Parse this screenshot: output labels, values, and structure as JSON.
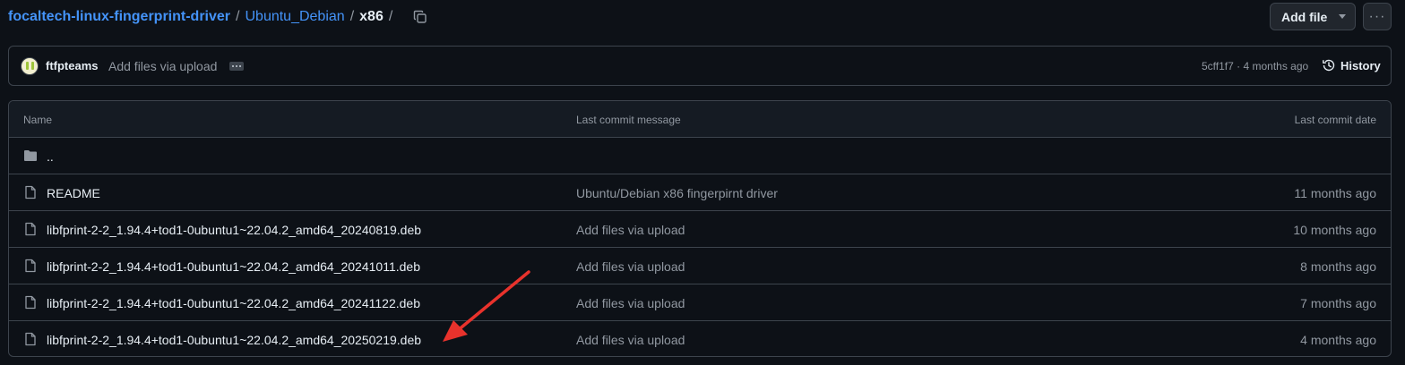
{
  "breadcrumb": {
    "repo": "focaltech-linux-fingerprint-driver",
    "sep1": "/",
    "folder": "Ubuntu_Debian",
    "sep2": "/",
    "current": "x86",
    "sep3": "/"
  },
  "toolbar": {
    "add_file_label": "Add file",
    "more_label": "···"
  },
  "commit": {
    "author": "ftfpteams",
    "message": "Add files via upload",
    "meta": "5cff1f7 · 4 months ago",
    "history_label": "History"
  },
  "table": {
    "headers": {
      "name": "Name",
      "message": "Last commit message",
      "date": "Last commit date"
    },
    "parent_label": "..",
    "rows": [
      {
        "name": "README",
        "message": "Ubuntu/Debian x86 fingerpirnt driver",
        "date": "11 months ago"
      },
      {
        "name": "libfprint-2-2_1.94.4+tod1-0ubuntu1~22.04.2_amd64_20240819.deb",
        "message": "Add files via upload",
        "date": "10 months ago"
      },
      {
        "name": "libfprint-2-2_1.94.4+tod1-0ubuntu1~22.04.2_amd64_20241011.deb",
        "message": "Add files via upload",
        "date": "8 months ago"
      },
      {
        "name": "libfprint-2-2_1.94.4+tod1-0ubuntu1~22.04.2_amd64_20241122.deb",
        "message": "Add files via upload",
        "date": "7 months ago"
      },
      {
        "name": "libfprint-2-2_1.94.4+tod1-0ubuntu1~22.04.2_amd64_20250219.deb",
        "message": "Add files via upload",
        "date": "4 months ago"
      }
    ]
  },
  "colors": {
    "background": "#0d1117",
    "link": "#4493f8",
    "border": "#3d444d",
    "muted": "#9198a1",
    "annotation_arrow": "#e8322c"
  },
  "icons": [
    "copy-icon",
    "chevron-down-icon",
    "kebab-icon",
    "commit-ellipsis-icon",
    "history-icon",
    "folder-icon",
    "file-icon"
  ]
}
